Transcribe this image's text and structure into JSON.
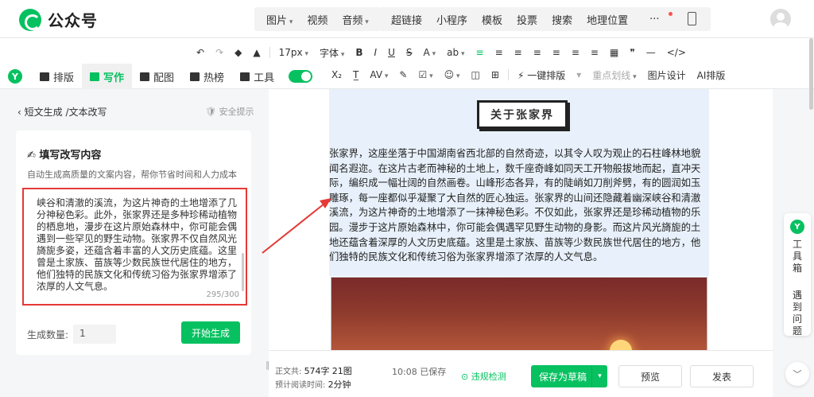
{
  "app": {
    "title": "公众号",
    "brand_color": "#07c160"
  },
  "insert_menu": [
    "图片",
    "视频",
    "音频"
  ],
  "insert_menu2": [
    "超链接",
    "小程序",
    "模板",
    "投票",
    "搜索",
    "地理位置",
    "···"
  ],
  "format_toolbar": {
    "row1": [
      "↶",
      "↷",
      "◆",
      "▲",
      "17px",
      "字体",
      "B",
      "I",
      "U",
      "S",
      "A",
      "ab",
      "≡",
      "≡",
      "≡",
      "≡",
      "≡",
      "≡",
      "≡",
      "▦",
      "❞",
      "—",
      "</>"
    ],
    "row2": [
      "X₂",
      "T̲",
      "AV",
      "✎",
      "☑",
      "☺",
      "◫",
      "⊞",
      "⚡ 一键排版",
      "▾",
      "重点划线",
      "图片设计",
      "AI排版"
    ]
  },
  "left_tabs": [
    "排版",
    "写作",
    "配图",
    "热榜",
    "工具"
  ],
  "panel": {
    "breadcrumb": "短文生成 /文本改写",
    "safety": "安全提示",
    "card_title": "✍ 填写改写内容",
    "card_desc": "自动生成高质量的文案内容，帮你节省时间和人力成本",
    "input_text": "峡谷和清澈的溪流，为这片神奇的土地增添了几分神秘色彩。此外，张家界还是多种珍稀动植物的栖息地，漫步在这片原始森林中，你可能会偶遇到一些罕见的野生动物。张家界不仅自然风光旖旎多姿，还蕴含着丰富的人文历史底蕴。这里曾是土家族、苗族等少数民族世代居住的地方，他们独特的民族文化和传统习俗为张家界增添了浓厚的人文气息。",
    "char_count": "295/300",
    "count_label": "生成数量:",
    "count_value": "1",
    "generate_label": "开始生成"
  },
  "editor": {
    "article_title": "关于张家界",
    "article_body": "张家界，这座坐落于中国湖南省西北部的自然奇迹，以其令人叹为观止的石柱峰林地貌闻名遐迩。在这片古老而神秘的土地上，数千座奇峰如同天工开物般拔地而起，直冲天际，编织成一幅壮阔的自然画卷。山峰形态各异，有的陡峭如刀削斧劈，有的圆润如玉雕琢，每一座都似乎凝聚了大自然的匠心独运。张家界的山间还隐藏着幽深峡谷和清澈溪流，为这片神奇的土地增添了一抹神秘色彩。不仅如此，张家界还是珍稀动植物的乐园。漫步于这片原始森林中，你可能会偶遇罕见野生动物的身影。而这片风光旖旎的土地还蕴含着深厚的人文历史底蕴。这里是土家族、苗族等少数民族世代居住的地方，他们独特的民族文化和传统习俗为张家界增添了浓厚的人文气息。"
  },
  "toolbox": {
    "label": "工具箱",
    "feedback": "遇到问题"
  },
  "footer": {
    "chars_label": "正文共:",
    "chars_value": "574字",
    "images_value": "21图",
    "read_label": "预计阅读时间:",
    "read_value": "2分钟",
    "saved_time": "10:08",
    "saved_label": "已保存",
    "check_label": "违规检测",
    "save_draft": "保存为草稿",
    "preview": "预览",
    "publish": "发表"
  },
  "colors": {
    "accent": "#07c160",
    "highlight_border": "#e53935",
    "selection_bg": "#e8f1fb"
  }
}
